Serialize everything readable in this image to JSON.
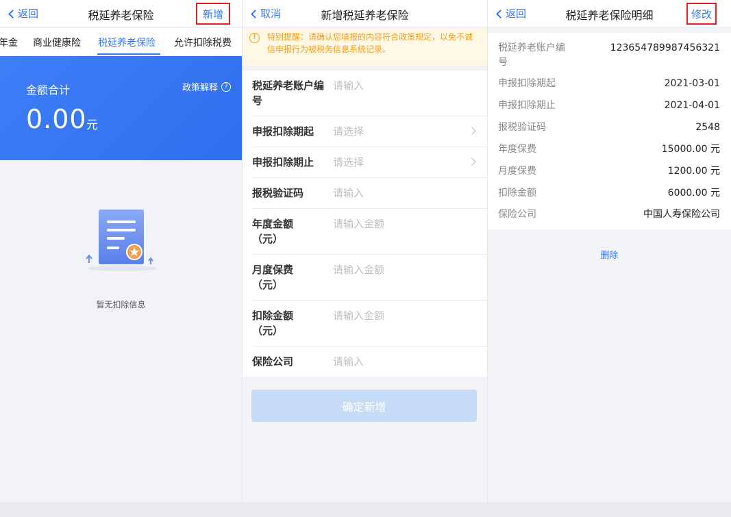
{
  "panel_list": {
    "back_label": "返回",
    "title": "税延养老保险",
    "action_label": "新增",
    "tabs": [
      "年金",
      "商业健康险",
      "税延养老保险",
      "允许扣除税费"
    ],
    "summary": {
      "label": "金额合计",
      "policy_link": "政策解释",
      "amount": "0.00",
      "unit": "元"
    },
    "empty_text": "暂无扣除信息"
  },
  "panel_form": {
    "cancel_label": "取消",
    "title": "新增税延养老保险",
    "notice": "特别提醒：请确认您填报的内容符合政策规定，以免不诚信申报行为被税务信息系统记录。",
    "fields": [
      {
        "label": "税延养老账户编号",
        "placeholder": "请输入"
      },
      {
        "label": "申报扣除期起",
        "placeholder": "请选择"
      },
      {
        "label": "申报扣除期止",
        "placeholder": "请选择"
      },
      {
        "label": "报税验证码",
        "placeholder": "请输入"
      },
      {
        "label": "年度金额（元）",
        "placeholder": "请输入金额"
      },
      {
        "label": "月度保费（元）",
        "placeholder": "请输入金额"
      },
      {
        "label": "扣除金额（元）",
        "placeholder": "请输入金额"
      },
      {
        "label": "保险公司",
        "placeholder": "请输入"
      }
    ],
    "submit_label": "确定新增"
  },
  "panel_detail": {
    "back_label": "返回",
    "title": "税延养老保险明细",
    "action_label": "修改",
    "rows": [
      {
        "label": "税延养老账户编号",
        "value": "123654789987456321"
      },
      {
        "label": "申报扣除期起",
        "value": "2021-03-01"
      },
      {
        "label": "申报扣除期止",
        "value": "2021-04-01"
      },
      {
        "label": "报税验证码",
        "value": "2548"
      },
      {
        "label": "年度保费",
        "value": "15000.00 元"
      },
      {
        "label": "月度保费",
        "value": "1200.00 元"
      },
      {
        "label": "扣除金额",
        "value": "6000.00 元"
      },
      {
        "label": "保险公司",
        "value": "中国人寿保险公司"
      }
    ],
    "delete_label": "删除"
  },
  "colors": {
    "accent": "#3478f6",
    "highlight_box": "#e02020",
    "warning": "#f0a020",
    "summary_bg": "#3e7ef7"
  }
}
